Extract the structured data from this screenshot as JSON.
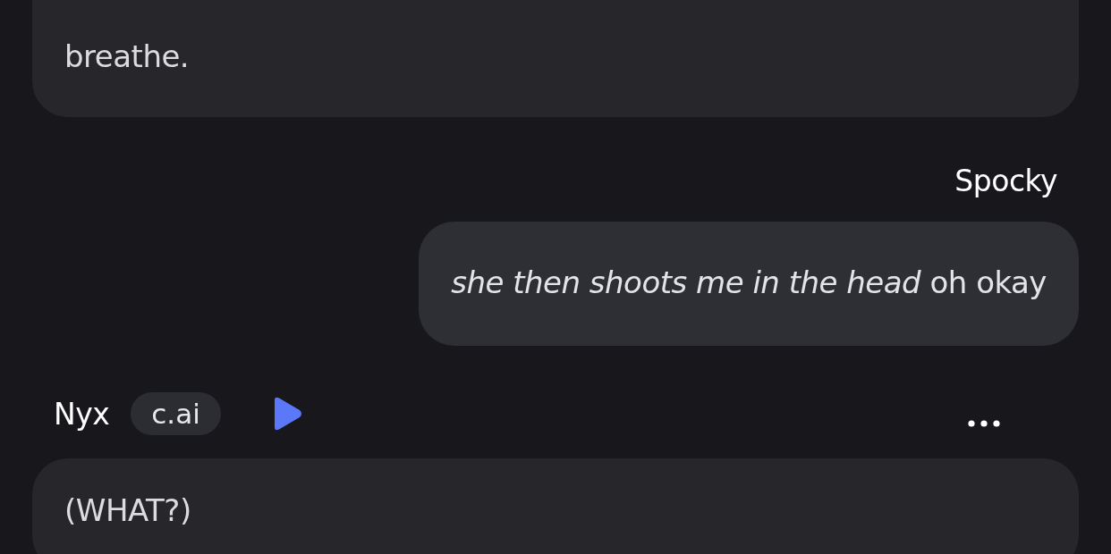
{
  "messages": [
    {
      "kind": "bot",
      "text": "breathe."
    },
    {
      "kind": "user",
      "author": "Spocky",
      "text": "*she then shoots me in the head* oh okay"
    },
    {
      "kind": "bot",
      "author": "Nyx",
      "badge": "c.ai",
      "text": "(WHAT?)"
    }
  ]
}
